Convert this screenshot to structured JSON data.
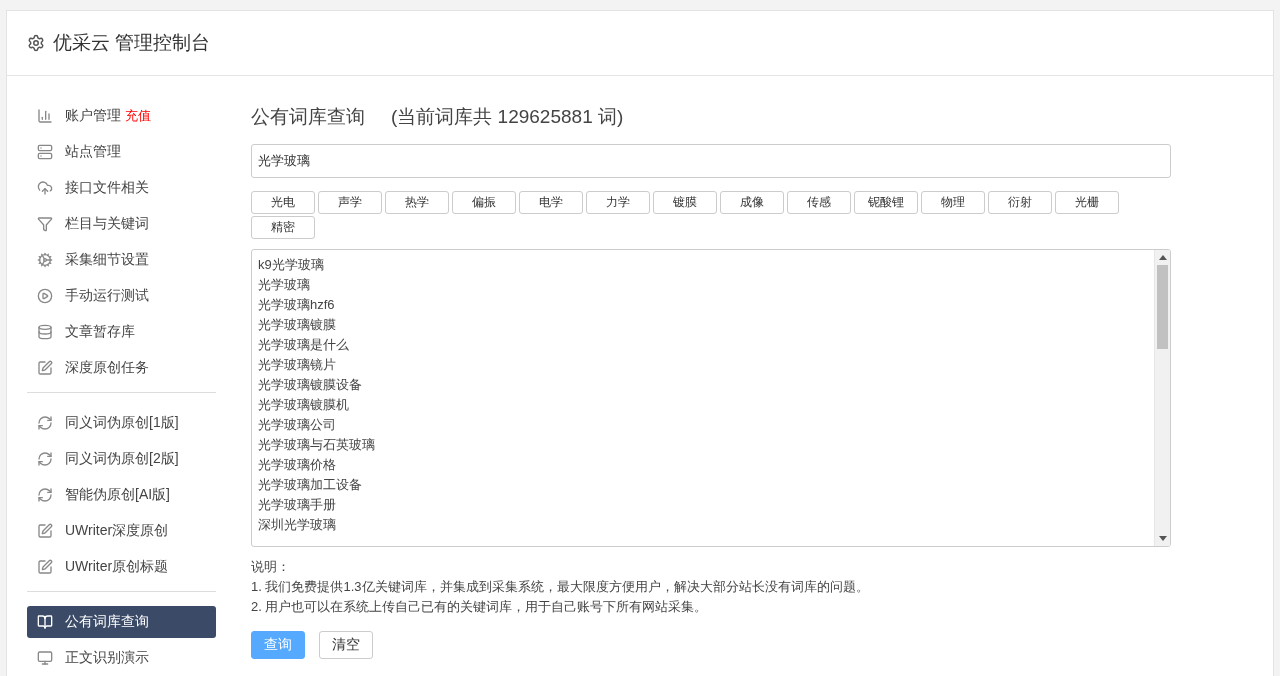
{
  "header": {
    "title": "优采云 管理控制台"
  },
  "sidebar": {
    "groups": [
      {
        "items": [
          {
            "label": "账户管理",
            "badge": "充值",
            "selected": false
          },
          {
            "label": "站点管理",
            "selected": false
          },
          {
            "label": "接口文件相关",
            "selected": false
          },
          {
            "label": "栏目与关键词",
            "selected": false
          },
          {
            "label": "采集细节设置",
            "selected": false
          },
          {
            "label": "手动运行测试",
            "selected": false
          },
          {
            "label": "文章暂存库",
            "selected": false
          },
          {
            "label": "深度原创任务",
            "selected": false
          }
        ]
      },
      {
        "items": [
          {
            "label": "同义词伪原创[1版]",
            "selected": false
          },
          {
            "label": "同义词伪原创[2版]",
            "selected": false
          },
          {
            "label": "智能伪原创[AI版]",
            "selected": false
          },
          {
            "label": "UWriter深度原创",
            "selected": false
          },
          {
            "label": "UWriter原创标题",
            "selected": false
          }
        ]
      },
      {
        "items": [
          {
            "label": "公有词库查询",
            "selected": true
          },
          {
            "label": "正文识别演示",
            "selected": false
          }
        ]
      }
    ]
  },
  "main": {
    "title": "公有词库查询",
    "count_text": "(当前词库共 129625881 词)",
    "search": {
      "value": "光学玻璃"
    },
    "tags": [
      "光电",
      "声学",
      "热学",
      "偏振",
      "电学",
      "力学",
      "镀膜",
      "成像",
      "传感",
      "铌酸锂",
      "物理",
      "衍射",
      "光栅",
      "精密"
    ],
    "results": [
      "k9光学玻璃",
      "光学玻璃",
      "光学玻璃hzf6",
      "光学玻璃镀膜",
      "光学玻璃是什么",
      "光学玻璃镜片",
      "光学玻璃镀膜设备",
      "光学玻璃镀膜机",
      "光学玻璃公司",
      "光学玻璃与石英玻璃",
      "光学玻璃价格",
      "光学玻璃加工设备",
      "光学玻璃手册",
      "深圳光学玻璃"
    ],
    "notes": [
      "说明：",
      "1. 我们免费提供1.3亿关键词库，并集成到采集系统，最大限度方便用户，解决大部分站长没有词库的问题。",
      "2. 用户也可以在系统上传自己已有的关键词库，用于自己账号下所有网站采集。"
    ],
    "buttons": [
      {
        "label": "查询",
        "kind": "primary"
      },
      {
        "label": "清空",
        "kind": "default"
      }
    ]
  }
}
